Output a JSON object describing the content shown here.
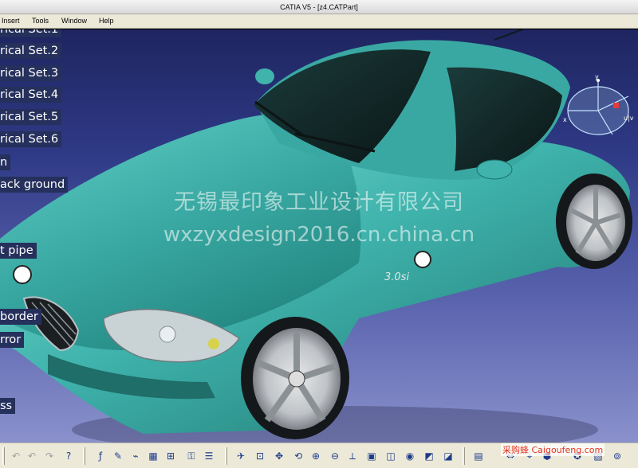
{
  "window": {
    "title": "CATIA V5 - [z4.CATPart]"
  },
  "menu": {
    "items": [
      {
        "label": "Insert"
      },
      {
        "label": "Tools"
      },
      {
        "label": "Window"
      },
      {
        "label": "Help"
      }
    ]
  },
  "tree": {
    "labels": [
      "rical Set.1",
      "rical Set.2",
      "rical Set.3",
      "rical Set.4",
      "rical Set.5",
      "rical Set.6",
      "n",
      "ack ground",
      "t pipe",
      " border",
      "rror",
      "ss"
    ]
  },
  "model": {
    "badge": "3.0si",
    "body_color": "#3fb3ac",
    "background_top": "#1e2560",
    "background_bottom": "#8a91cc"
  },
  "compass": {
    "axis_x": "x",
    "axis_y": "y",
    "axis_z": "u|v"
  },
  "watermarks": {
    "line1": "无锡最印象工业设计有限公司",
    "line2": "wxzyxdesign2016.cn.china.cn",
    "site": "采购蜂 Caigoufeng.com"
  },
  "toolbar": {
    "icons": [
      "undo-icon",
      "redo-icon",
      "help-arrow-icon",
      "formula-icon",
      "comment-icon",
      "table-icon",
      "grid-icon",
      "lock-icon",
      "analysis-icon",
      "fly-mode-icon",
      "fit-all-icon",
      "pan-icon",
      "rotate-icon",
      "zoom-in-icon",
      "zoom-out-icon",
      "normal-view-icon",
      "multi-view-icon",
      "iso-view-icon",
      "render-style-icon",
      "hide-show-icon",
      "swap-space-icon",
      "catalog-icon",
      "measure-icon",
      "apply-material-icon",
      "cylinder-icon"
    ]
  }
}
